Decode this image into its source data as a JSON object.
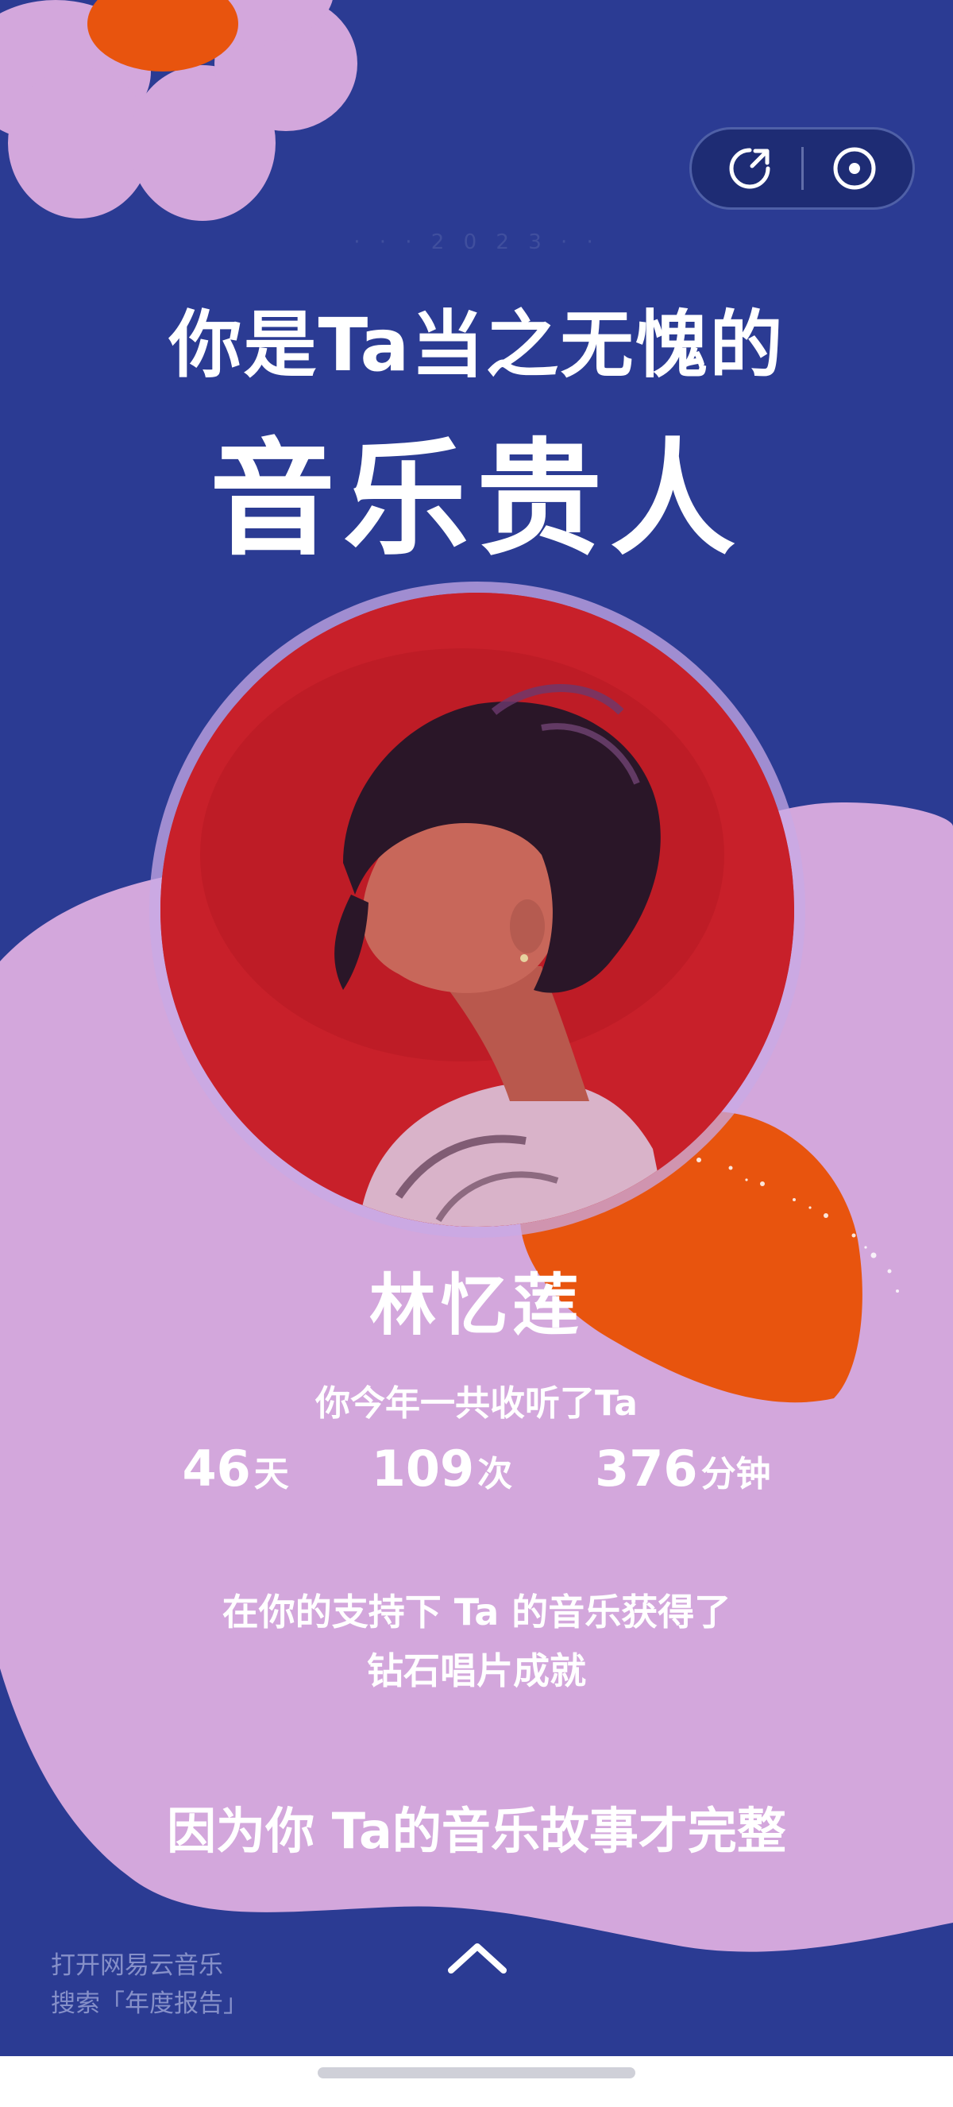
{
  "colors": {
    "background": "#2b3b93",
    "lilac": "#d3a7dc",
    "orange": "#e8540e",
    "photo_red": "#c8202a"
  },
  "toolbar": {
    "share_icon": "share-arrow-icon",
    "record_icon": "record-disc-icon"
  },
  "header": {
    "faint_text": "· · · 2 0 2 3 · ·"
  },
  "headline": {
    "line1": "你是Ta当之无愧的",
    "line2": "音乐贵人"
  },
  "artist": {
    "name": "林忆莲"
  },
  "stats": {
    "label": "你今年一共收听了Ta",
    "items": [
      {
        "value": "46",
        "unit": "天"
      },
      {
        "value": "109",
        "unit": "次"
      },
      {
        "value": "376",
        "unit": "分钟"
      }
    ]
  },
  "achievement": {
    "line1": "在你的支持下  Ta 的音乐获得了",
    "line2": "钻石唱片成就"
  },
  "closing": {
    "text": "因为你  Ta的音乐故事才完整"
  },
  "footer": {
    "hint_line1": "打开网易云音乐",
    "hint_line2": "搜索「年度报告」",
    "swipe_icon": "chevron-up-icon"
  }
}
